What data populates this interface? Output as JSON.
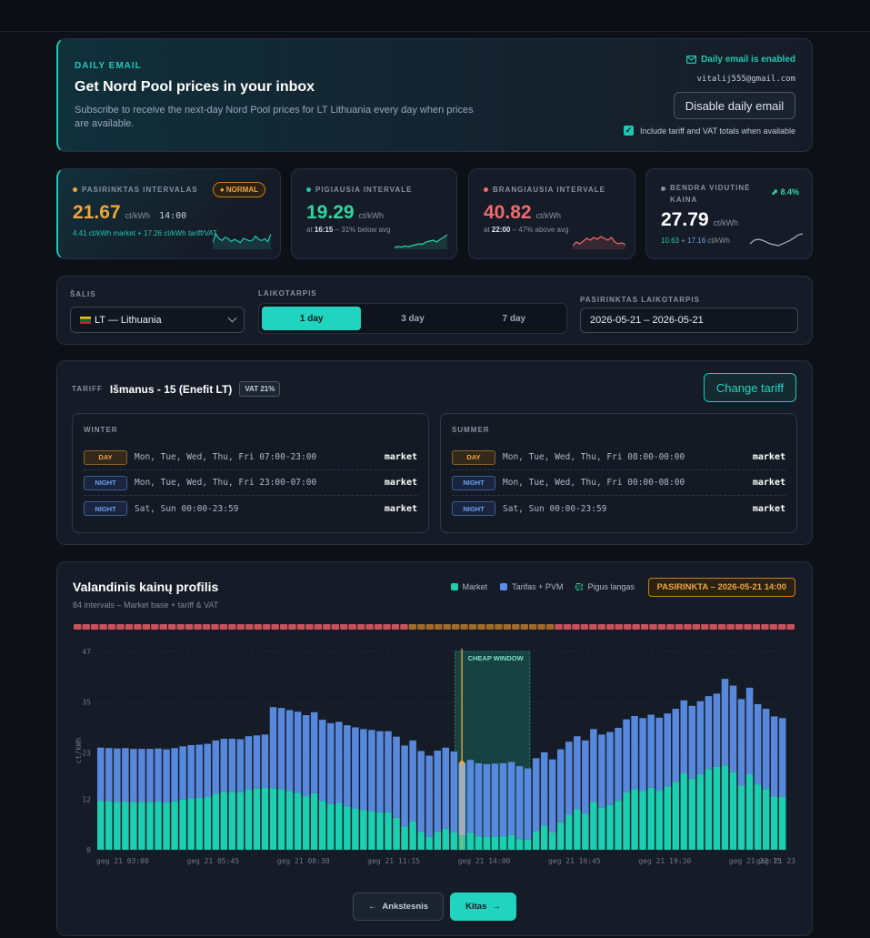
{
  "email": {
    "eyebrow": "DAILY EMAIL",
    "title": "Get Nord Pool prices in your inbox",
    "description": "Subscribe to receive the next-day Nord Pool prices for LT Lithuania every day when prices are available.",
    "status": "Daily email is enabled",
    "address": "vitalij555@gmail.com",
    "disable_label": "Disable daily email",
    "include_label": "Include tariff and VAT totals when available",
    "include_checked": true
  },
  "stats": {
    "selected": {
      "label": "PASIRINKTAS INTERVALAS",
      "badge": "NORMAL",
      "value": "21.67",
      "unit": "ct/kWh",
      "time": "14:00",
      "sub": "4.41 ct/kWh market + 17.26 ct/kWh tariff/VAT",
      "spark": [
        0.7,
        0.3,
        0.5,
        0.6,
        0.45,
        0.5,
        0.65,
        0.55,
        0.6,
        0.7,
        0.5,
        0.55,
        0.62,
        0.58,
        0.4,
        0.55,
        0.6,
        0.52,
        0.65,
        0.3
      ]
    },
    "cheap": {
      "label": "PIGIAUSIA INTERVALE",
      "value": "19.29",
      "unit": "ct/kWh",
      "sub_prefix": "at",
      "sub_time": "16:15",
      "sub_suffix": "– 31% below avg",
      "spark": [
        0.9,
        0.85,
        0.88,
        0.82,
        0.86,
        0.8,
        0.75,
        0.7,
        0.72,
        0.6,
        0.55,
        0.5,
        0.6,
        0.45,
        0.35,
        0.2
      ]
    },
    "expensive": {
      "label": "BRANGIAUSIA INTERVALE",
      "value": "40.82",
      "unit": "ct/kWh",
      "sub_prefix": "at",
      "sub_time": "22:00",
      "sub_suffix": "– 47% above avg",
      "spark": [
        0.8,
        0.6,
        0.7,
        0.55,
        0.4,
        0.5,
        0.35,
        0.45,
        0.3,
        0.4,
        0.5,
        0.35,
        0.6,
        0.7,
        0.65,
        0.75
      ]
    },
    "average": {
      "label_line1": "BENDRA VIDUTINĖ",
      "label_line2": "KAINA",
      "trend": "8.4%",
      "value": "27.79",
      "unit": "ct/kWh",
      "sub_a": "10.63",
      "sub_b": "17.16",
      "sub_unit": "ct/kWh",
      "spark": [
        0.7,
        0.5,
        0.45,
        0.5,
        0.6,
        0.7,
        0.75,
        0.8,
        0.7,
        0.6,
        0.5,
        0.35,
        0.2,
        0.15
      ]
    }
  },
  "filters": {
    "country_label": "ŠALIS",
    "country_value": "LT — Lithuania",
    "period_label": "LAIKOTARPIS",
    "periods": [
      "1 day",
      "3 day",
      "7 day"
    ],
    "active_period": "1 day",
    "range_label": "PASIRINKTAS LAIKOTARPIS",
    "range_value": "2026-05-21 – 2026-05-21"
  },
  "tariff": {
    "label": "TARIFF",
    "name": "Išmanus - 15 (Enefit LT)",
    "vat": "VAT 21%",
    "change_label": "Change tariff",
    "seasons": [
      {
        "title": "WINTER",
        "rows": [
          {
            "type": "DAY",
            "schedule": "Mon, Tue, Wed, Thu, Fri 07:00-23:00",
            "source": "market"
          },
          {
            "type": "NIGHT",
            "schedule": "Mon, Tue, Wed, Thu, Fri 23:00-07:00",
            "source": "market"
          },
          {
            "type": "NIGHT",
            "schedule": "Sat, Sun 00:00-23:59",
            "source": "market"
          }
        ]
      },
      {
        "title": "SUMMER",
        "rows": [
          {
            "type": "DAY",
            "schedule": "Mon, Tue, Wed, Thu, Fri 08:00-00:00",
            "source": "market"
          },
          {
            "type": "NIGHT",
            "schedule": "Mon, Tue, Wed, Thu, Fri 00:00-08:00",
            "source": "market"
          },
          {
            "type": "NIGHT",
            "schedule": "Sat, Sun 00:00-23:59",
            "source": "market"
          }
        ]
      }
    ]
  },
  "chart_section": {
    "title": "Valandinis kainų profilis",
    "subtitle": "84 intervals – Market base + tariff & VAT",
    "legend": [
      "Market",
      "Tarifas + PVM",
      "Pigus langas"
    ],
    "selected_badge": "PASIRINKTA – 2026-05-21 14:00",
    "cheap_window_label": "CHEAP WINDOW",
    "prev_label": "Ankstesnis",
    "next_label": "Kitas"
  },
  "colors": {
    "accent": "#21d4bf",
    "market": "#1ccfb0",
    "tariff": "#5b8ee6",
    "expensive": "#f06b6b",
    "selected": "#f0a63c"
  },
  "chart_data": {
    "type": "bar",
    "stacked": true,
    "ylabel": "ct/kWh",
    "yticks": [
      0,
      12,
      23,
      35,
      47
    ],
    "ylim": [
      0,
      47
    ],
    "xtick_labels": [
      "geg 21 03:00",
      "geg 21 05:45",
      "geg 21 08:30",
      "geg 21 11:15",
      "geg 21 14:00",
      "geg 21 16:45",
      "geg 21 19:30",
      "geg 21 22:15",
      "geg 21 23"
    ],
    "selected_index": 44,
    "cheap_window": [
      44,
      52
    ],
    "series": [
      {
        "name": "Market",
        "values": [
          11.6,
          11.5,
          11.3,
          11.4,
          11.3,
          11.3,
          11.3,
          11.4,
          11.2,
          11.5,
          11.9,
          12.2,
          12.3,
          12.5,
          13.3,
          13.7,
          13.7,
          13.6,
          14.3,
          14.5,
          14.7,
          14.6,
          14.4,
          13.9,
          13.5,
          12.7,
          13.4,
          11.6,
          10.8,
          11.1,
          10.3,
          9.8,
          9.4,
          9.2,
          8.9,
          8.9,
          7.6,
          5.5,
          6.7,
          4.2,
          3.1,
          4.3,
          5.0,
          4.1,
          3.3,
          4.0,
          3.2,
          3.0,
          3.1,
          3.2,
          3.5,
          2.5,
          2.4,
          4.4,
          5.8,
          4.1,
          6.5,
          8.3,
          9.6,
          8.6,
          11.3,
          10.0,
          10.6,
          11.6,
          13.6,
          14.4,
          13.9,
          14.7,
          14.0,
          15.0,
          16.1,
          18.1,
          16.8,
          17.9,
          19.1,
          19.7,
          20.0,
          18.4,
          15.2,
          17.9,
          15.5,
          14.4,
          12.6,
          12.5
        ]
      },
      {
        "name": "Tarifas + PVM",
        "values": [
          12.6,
          12.6,
          12.7,
          12.7,
          12.6,
          12.6,
          12.6,
          12.6,
          12.6,
          12.6,
          12.6,
          12.6,
          12.6,
          12.6,
          12.6,
          12.6,
          12.6,
          12.6,
          12.6,
          12.6,
          12.6,
          19.2,
          19.2,
          19.2,
          19.2,
          19.2,
          19.2,
          19.2,
          19.2,
          19.2,
          19.2,
          19.2,
          19.2,
          19.2,
          19.2,
          19.2,
          19.2,
          19.2,
          19.2,
          19.2,
          19.2,
          19.2,
          19.2,
          19.2,
          17.3,
          17.3,
          17.3,
          17.3,
          17.3,
          17.3,
          17.3,
          17.3,
          16.9,
          17.3,
          17.3,
          17.3,
          17.3,
          17.3,
          17.3,
          17.3,
          17.3,
          17.3,
          17.3,
          17.3,
          17.3,
          17.3,
          17.3,
          17.3,
          17.3,
          17.3,
          17.3,
          17.3,
          17.3,
          17.3,
          17.3,
          17.3,
          20.5,
          20.5,
          20.5,
          20.5,
          19.0,
          19.0,
          19.0,
          18.7
        ]
      }
    ],
    "price_strip": [
      "r",
      "r",
      "r",
      "r",
      "r",
      "r",
      "r",
      "r",
      "r",
      "r",
      "r",
      "r",
      "r",
      "r",
      "r",
      "r",
      "r",
      "r",
      "r",
      "r",
      "r",
      "r",
      "r",
      "r",
      "r",
      "r",
      "r",
      "r",
      "r",
      "r",
      "r",
      "r",
      "r",
      "r",
      "r",
      "r",
      "r",
      "r",
      "r",
      "o",
      "o",
      "o",
      "o",
      "o",
      "o",
      "o",
      "o",
      "o",
      "o",
      "o",
      "o",
      "o",
      "o",
      "o",
      "o",
      "o",
      "r",
      "r",
      "r",
      "r",
      "r",
      "r",
      "r",
      "r",
      "r",
      "r",
      "r",
      "r",
      "r",
      "r",
      "r",
      "r",
      "r",
      "r",
      "r",
      "r",
      "r",
      "r",
      "r",
      "r",
      "r",
      "r",
      "r",
      "r"
    ]
  }
}
